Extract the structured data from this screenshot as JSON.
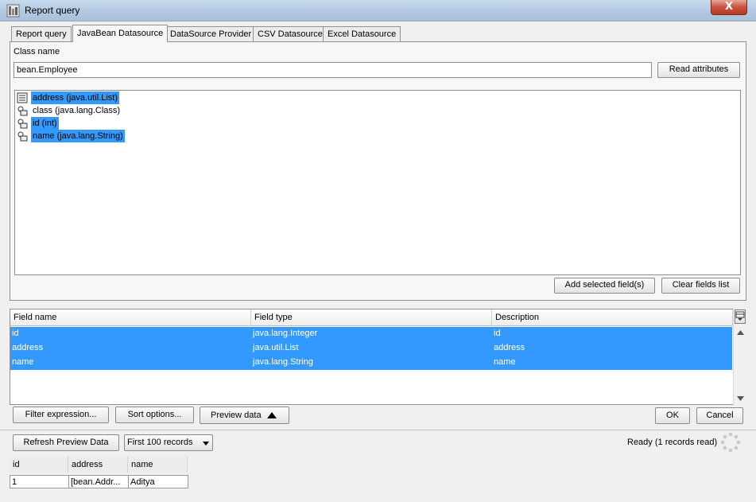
{
  "window": {
    "title": "Report query",
    "close_glyph": "X"
  },
  "tabs": [
    {
      "label": "Report query",
      "active": false
    },
    {
      "label": "JavaBean Datasource",
      "active": true
    },
    {
      "label": "DataSource Provider",
      "active": false
    },
    {
      "label": "CSV Datasource",
      "active": false
    },
    {
      "label": "Excel Datasource",
      "active": false
    }
  ],
  "class_section": {
    "label": "Class name",
    "value": "bean.Employee",
    "read_button": "Read attributes"
  },
  "attributes": [
    {
      "text": "address (java.util.List)",
      "icon": "list-field-icon",
      "selected": true
    },
    {
      "text": "class (java.lang.Class)",
      "icon": "bean-property-icon",
      "selected": false
    },
    {
      "text": "id (int)",
      "icon": "bean-property-icon",
      "selected": true
    },
    {
      "text": "name (java.lang.String)",
      "icon": "bean-property-icon",
      "selected": true
    }
  ],
  "attr_buttons": {
    "add_selected": "Add selected field(s)",
    "clear": "Clear fields list"
  },
  "fields_table": {
    "columns": [
      "Field name",
      "Field type",
      "Description"
    ],
    "rows": [
      {
        "name": "id",
        "type": "java.lang.Integer",
        "description": "id"
      },
      {
        "name": "address",
        "type": "java.util.List",
        "description": "address"
      },
      {
        "name": "name",
        "type": "java.lang.String",
        "description": "name"
      }
    ]
  },
  "bottom_buttons": {
    "filter": "Filter expression...",
    "sort": "Sort options...",
    "preview": "Preview data",
    "ok": "OK",
    "cancel": "Cancel"
  },
  "preview": {
    "refresh": "Refresh Preview Data",
    "records_select": "First 100 records",
    "status": "Ready (1 records read)",
    "columns": [
      "id",
      "address",
      "name"
    ],
    "rows": [
      {
        "id": "1",
        "address": "[bean.Addr...",
        "name": "Aditya"
      }
    ]
  },
  "colors": {
    "selection": "#3399ff",
    "titlebar": "#b6cbe2",
    "close": "#c8523f"
  }
}
